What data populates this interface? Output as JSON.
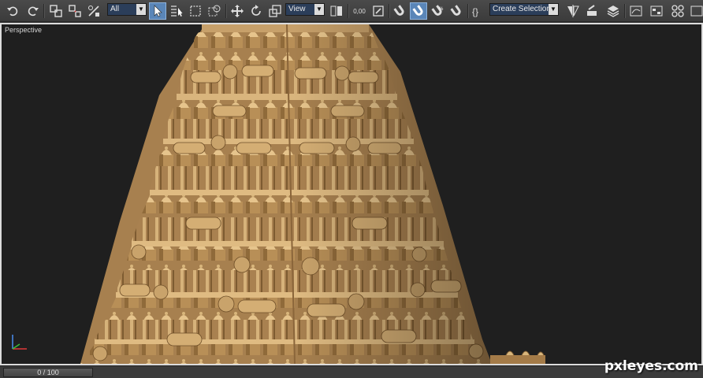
{
  "toolbar": {
    "selection_filter": "All",
    "reference_coord": "View",
    "spinner_snap_value": "0,00",
    "named_selection_placeholder": "Create Selection Set"
  },
  "viewport": {
    "label": "Perspective"
  },
  "timeline": {
    "frame": "0 / 100"
  },
  "watermark": "pxleyes.com",
  "colors": {
    "viewport_bg": "#1f1f1f",
    "model": "#c09a63",
    "active_button": "#5a86b8"
  }
}
